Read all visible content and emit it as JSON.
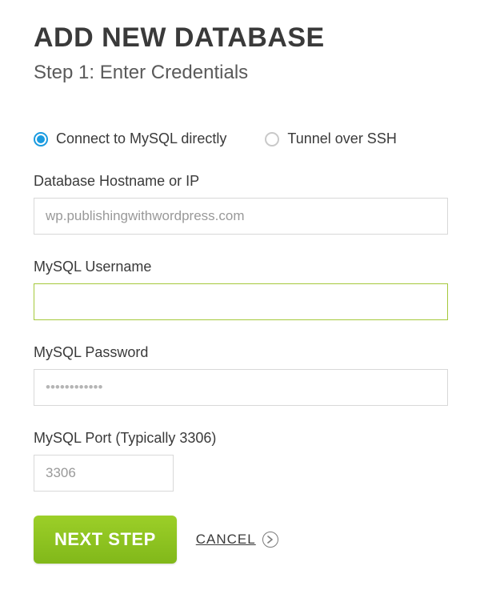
{
  "header": {
    "title": "ADD NEW DATABASE",
    "subtitle": "Step 1: Enter Credentials"
  },
  "connection": {
    "direct": {
      "label": "Connect to MySQL directly",
      "selected": true
    },
    "ssh": {
      "label": "Tunnel over SSH",
      "selected": false
    }
  },
  "fields": {
    "hostname": {
      "label": "Database Hostname or IP",
      "value": "wp.publishingwithwordpress.com"
    },
    "username": {
      "label": "MySQL Username",
      "value": ""
    },
    "password": {
      "label": "MySQL Password",
      "value": "",
      "placeholder": "••••••••••••"
    },
    "port": {
      "label": "MySQL Port (Typically 3306)",
      "value": "3306"
    }
  },
  "actions": {
    "next": "NEXT STEP",
    "cancel": "CANCEL"
  }
}
